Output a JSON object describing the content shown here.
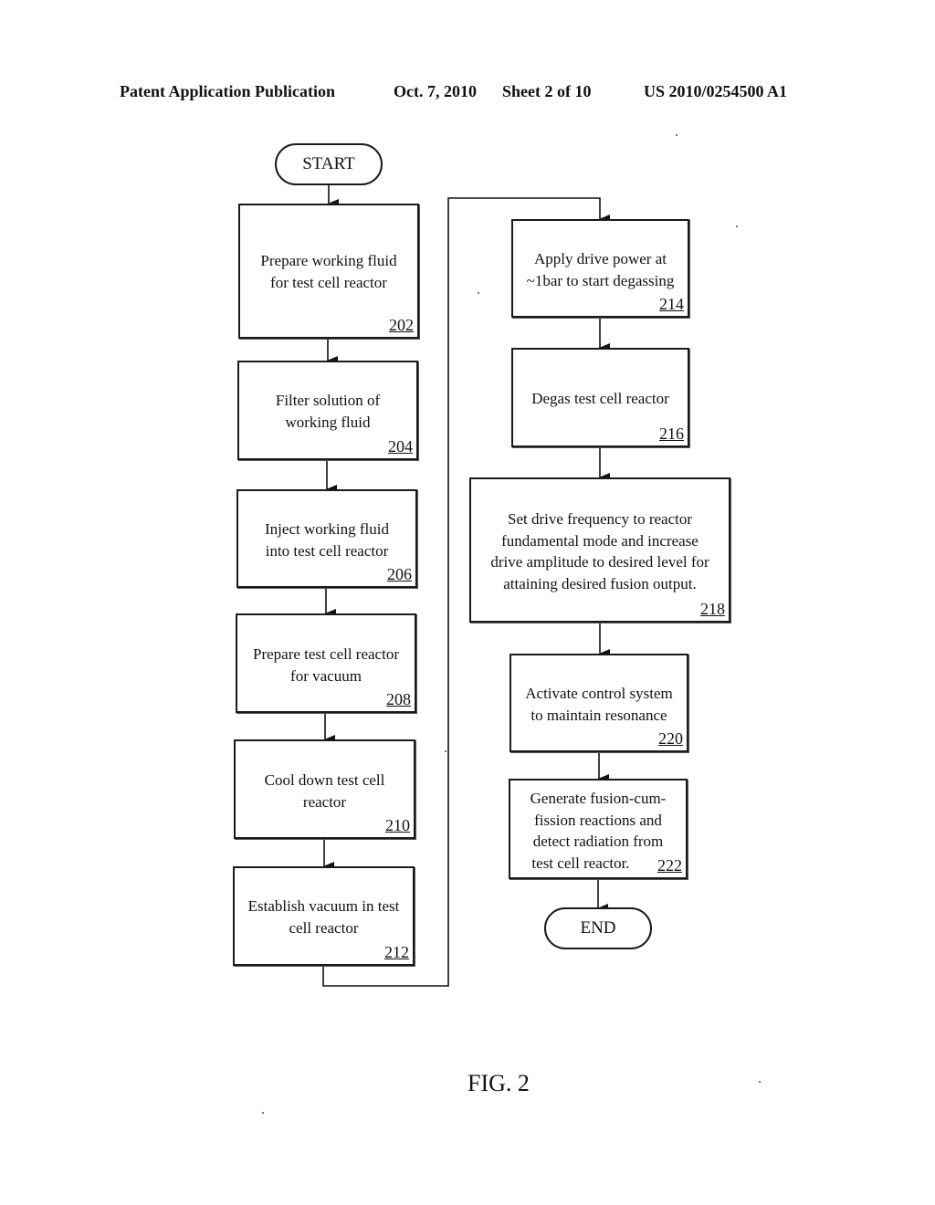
{
  "header": {
    "publication": "Patent Application Publication",
    "date": "Oct. 7, 2010",
    "sheet": "Sheet 2 of 10",
    "number": "US 2010/0254500 A1"
  },
  "flowchart": {
    "start": "START",
    "end": "END",
    "steps": [
      {
        "id": "202",
        "lines": [
          "Prepare working fluid",
          "for test cell reactor"
        ]
      },
      {
        "id": "204",
        "lines": [
          "Filter solution of",
          "working fluid"
        ]
      },
      {
        "id": "206",
        "lines": [
          "Inject working fluid",
          "into test cell reactor"
        ]
      },
      {
        "id": "208",
        "lines": [
          "Prepare test cell reactor",
          "for vacuum"
        ]
      },
      {
        "id": "210",
        "lines": [
          "Cool down test cell",
          "reactor"
        ]
      },
      {
        "id": "212",
        "lines": [
          "Establish vacuum in test",
          "cell reactor"
        ]
      },
      {
        "id": "214",
        "lines": [
          "Apply drive power at",
          "~1bar to start degassing"
        ]
      },
      {
        "id": "216",
        "lines": [
          "Degas test cell reactor"
        ]
      },
      {
        "id": "218",
        "lines": [
          "Set drive frequency to reactor",
          "fundamental mode and increase",
          "drive amplitude to desired level for",
          "attaining desired fusion output."
        ]
      },
      {
        "id": "220",
        "lines": [
          "Activate control system",
          "to maintain resonance"
        ]
      },
      {
        "id": "222",
        "lines": [
          "Generate fusion-cum-",
          "fission reactions and",
          "detect radiation from",
          "test cell reactor."
        ]
      }
    ]
  },
  "caption": "FIG. 2"
}
